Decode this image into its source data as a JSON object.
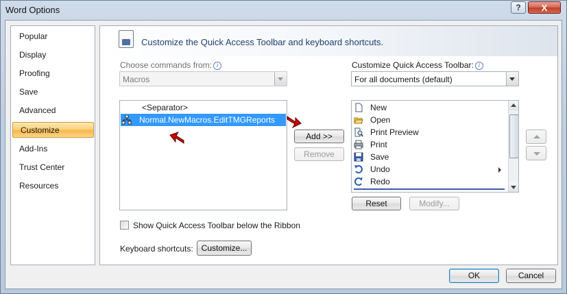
{
  "window": {
    "title": "Word Options",
    "help_label": "?",
    "close_label": "X"
  },
  "categories": [
    {
      "label": "Popular"
    },
    {
      "label": "Display"
    },
    {
      "label": "Proofing"
    },
    {
      "label": "Save"
    },
    {
      "label": "Advanced"
    },
    {
      "label": "Customize",
      "selected": true
    },
    {
      "label": "Add-Ins"
    },
    {
      "label": "Trust Center"
    },
    {
      "label": "Resources"
    }
  ],
  "header": {
    "title": "Customize the Quick Access Toolbar and keyboard shortcuts."
  },
  "choose": {
    "label": "Choose commands from:",
    "value": "Macros"
  },
  "commands": {
    "items": [
      {
        "label": "<Separator>",
        "selected": false
      },
      {
        "label": "Normal.NewMacros.EditTMGReports",
        "selected": true
      }
    ]
  },
  "customize": {
    "label": "Customize Quick Access Toolbar:",
    "value": "For all documents (default)"
  },
  "toolbar_items": [
    {
      "label": "New",
      "icon": "new-doc-icon"
    },
    {
      "label": "Open",
      "icon": "open-folder-icon"
    },
    {
      "label": "Print Preview",
      "icon": "print-preview-icon"
    },
    {
      "label": "Print",
      "icon": "printer-icon"
    },
    {
      "label": "Save",
      "icon": "save-disk-icon"
    },
    {
      "label": "Undo",
      "icon": "undo-icon"
    },
    {
      "label": "Redo",
      "icon": "redo-icon"
    }
  ],
  "buttons": {
    "add": "Add >>",
    "remove": "Remove",
    "reset": "Reset",
    "modify": "Modify...",
    "customize_shortcuts": "Customize...",
    "ok": "OK",
    "cancel": "Cancel"
  },
  "show_below": {
    "label": "Show Quick Access Toolbar below the Ribbon",
    "checked": false
  },
  "keyboard": {
    "label": "Keyboard shortcuts:"
  },
  "colors": {
    "selection": "#3399ff",
    "accent": "#1f3f6e",
    "annotation_arrow": "#cc0000"
  }
}
